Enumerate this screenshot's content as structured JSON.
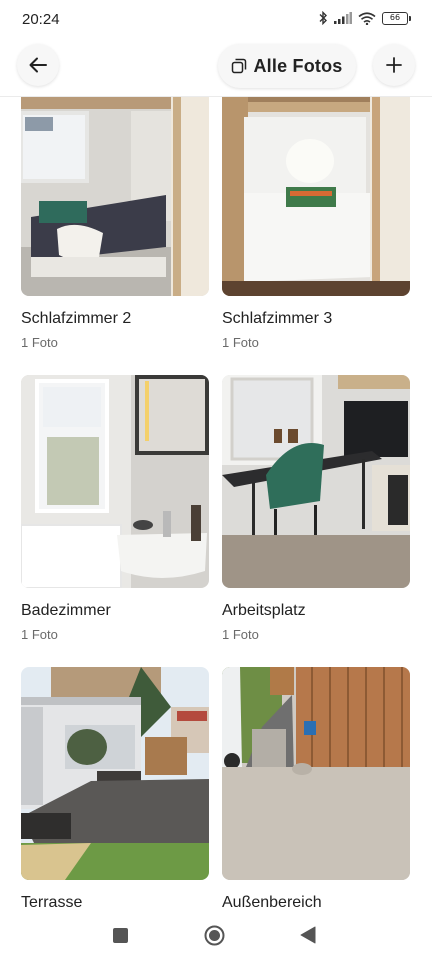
{
  "status_bar": {
    "time": "20:24",
    "battery": "66"
  },
  "header": {
    "back_icon": "arrow-left-icon",
    "title": "Alle Fotos",
    "title_icon": "photos-stack-icon",
    "add_icon": "plus-icon"
  },
  "rooms": [
    {
      "name": "Schlafzimmer 2",
      "count": "1 Foto"
    },
    {
      "name": "Schlafzimmer 3",
      "count": "1 Foto"
    },
    {
      "name": "Badezimmer",
      "count": "1 Foto"
    },
    {
      "name": "Arbeitsplatz",
      "count": "1 Foto"
    },
    {
      "name": "Terrasse",
      "count": ""
    },
    {
      "name": "Außenbereich",
      "count": ""
    }
  ],
  "nav_bar": {
    "recents_icon": "square-icon",
    "home_icon": "circle-icon",
    "back_icon": "triangle-back-icon"
  }
}
